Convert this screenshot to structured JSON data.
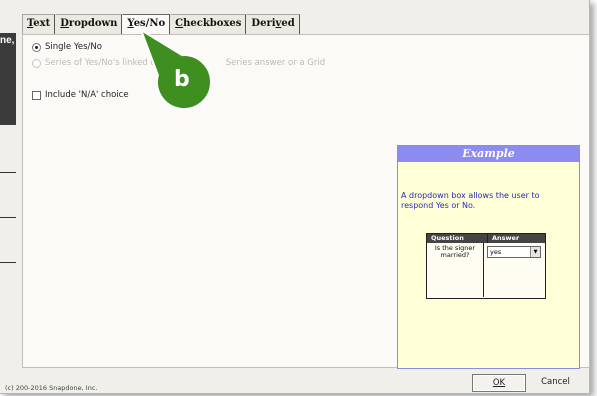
{
  "tabs": [
    {
      "pre": "",
      "u": "T",
      "post": "ext"
    },
    {
      "pre": "",
      "u": "D",
      "post": "ropdown"
    },
    {
      "pre": "",
      "u": "Y",
      "post": "es/No"
    },
    {
      "pre": "",
      "u": "C",
      "post": "heckboxes"
    },
    {
      "pre": "Deri",
      "u": "v",
      "post": "ed"
    }
  ],
  "options": {
    "single": "Single Yes/No",
    "series_a": "Series of Yes/No's linked t",
    "series_b": "Series answer or a Grid",
    "include_na": "Include 'N/A' choice"
  },
  "left_overlay_text": "ne,",
  "callout_label": "b",
  "example": {
    "title": "Example",
    "description": "A dropdown box allows the user to respond Yes or No.",
    "col_question": "Question",
    "col_answer": "Answer",
    "question_text": "Is the signer married?",
    "answer_value": "yes"
  },
  "footer": {
    "copyright": "(c) 200-2016 Snapdone, Inc.",
    "ok": "OK",
    "cancel": "Cancel"
  },
  "colors": {
    "callout": "#3f8f20",
    "example_header": "#8b8bf0",
    "example_bg": "#ffffd7"
  }
}
